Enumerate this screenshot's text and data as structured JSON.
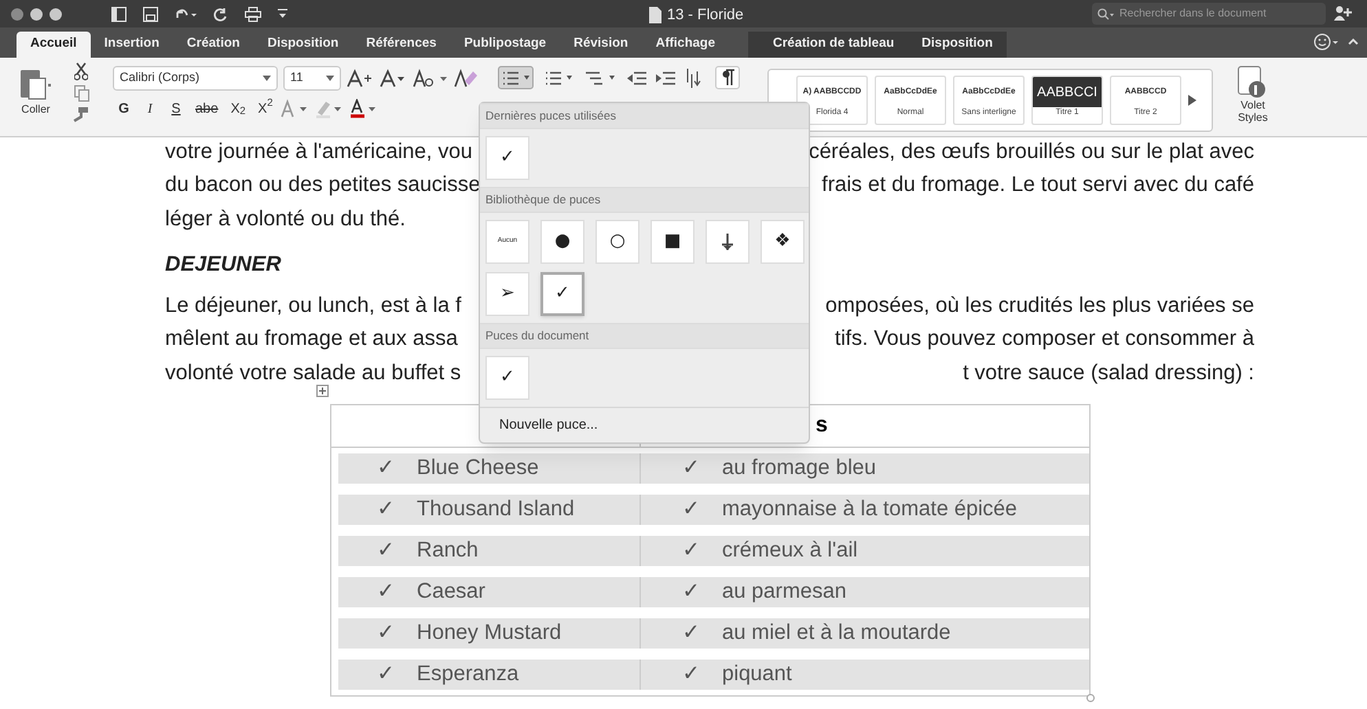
{
  "window": {
    "title": "13 - Floride",
    "search_placeholder": "Rechercher dans le document"
  },
  "tabs": [
    {
      "label": "Accueil",
      "selected": true,
      "contextual": false
    },
    {
      "label": "Insertion",
      "selected": false,
      "contextual": false
    },
    {
      "label": "Création",
      "selected": false,
      "contextual": false
    },
    {
      "label": "Disposition",
      "selected": false,
      "contextual": false
    },
    {
      "label": "Références",
      "selected": false,
      "contextual": false
    },
    {
      "label": "Publipostage",
      "selected": false,
      "contextual": false
    },
    {
      "label": "Révision",
      "selected": false,
      "contextual": false
    },
    {
      "label": "Affichage",
      "selected": false,
      "contextual": false
    },
    {
      "label": "Création de tableau",
      "selected": false,
      "contextual": true
    },
    {
      "label": "Disposition",
      "selected": false,
      "contextual": true
    }
  ],
  "ribbon": {
    "paste_label": "Coller",
    "font": "Calibri (Corps)",
    "size": "11",
    "format_buttons": [
      {
        "label": "G",
        "kind": "bold"
      },
      {
        "label": "I",
        "kind": "italic"
      },
      {
        "label": "S",
        "kind": "underline"
      },
      {
        "label": "abe",
        "kind": "strike"
      },
      {
        "label": "X$_{2}$",
        "kind": "plain"
      },
      {
        "label": "X$^{2}$",
        "kind": "plain"
      }
    ],
    "styles": [
      {
        "preview": "A) AABBCCDD",
        "name": "Florida 4",
        "dark": false
      },
      {
        "preview": "AaBbCcDdEe",
        "name": "Normal",
        "dark": false
      },
      {
        "preview": "AaBbCcDdEe",
        "name": "Sans interligne",
        "dark": false
      },
      {
        "preview": "AABBCCI",
        "name": "Titre 1",
        "dark": true
      },
      {
        "preview": "AABBCCD",
        "name": "Titre 2",
        "dark": false
      }
    ],
    "styles_pane": [
      "Volet",
      "Styles"
    ]
  },
  "document": {
    "lines": [
      {
        "kind": "split",
        "left": "votre journée à l'américaine, vou",
        "right": "céréales, des œufs brouillés ou sur le plat avec"
      },
      {
        "kind": "split",
        "left": "du bacon ou des petites saucisse",
        "right": "frais et du fromage. Le tout servi avec du café"
      },
      {
        "kind": "plain",
        "left": "léger à volonté ou du thé."
      },
      {
        "kind": "heading",
        "left": "DEJEUNER"
      },
      {
        "kind": "split",
        "left": "Le déjeuner, ou lunch, est à la f",
        "right": "omposées, où les crudités les plus variées se"
      },
      {
        "kind": "split",
        "left": "mêlent au fromage et aux assa",
        "right": "tifs. Vous pouvez composer et consommer à"
      },
      {
        "kind": "split",
        "left": "volonté votre salade au buffet s",
        "right": "t votre sauce (salad dressing) :"
      }
    ],
    "table": {
      "column_2_header": "s",
      "rows": [
        {
          "left": {
            "bullet": "✓",
            "text": "Blue Cheese"
          },
          "right": {
            "bullet": "✓",
            "text": "au fromage bleu"
          }
        },
        {
          "left": {
            "bullet": "✓",
            "text": "Thousand Island"
          },
          "right": {
            "bullet": "✓",
            "text": "mayonnaise à la tomate épicée"
          }
        },
        {
          "left": {
            "bullet": "✓",
            "text": "Ranch"
          },
          "right": {
            "bullet": "✓",
            "text": "crémeux à l'ail"
          }
        },
        {
          "left": {
            "bullet": "✓",
            "text": "Caesar"
          },
          "right": {
            "bullet": "✓",
            "text": "au parmesan"
          }
        },
        {
          "left": {
            "bullet": "✓",
            "text": "Honey Mustard"
          },
          "right": {
            "bullet": "✓",
            "text": "au miel et à la moutarde"
          }
        },
        {
          "left": {
            "bullet": "✓",
            "text": "Esperanza"
          },
          "right": {
            "bullet": "✓",
            "text": "piquant"
          }
        }
      ]
    }
  },
  "bullet_menu": {
    "sections": [
      {
        "title": "Dernières puces utilisées",
        "items": [
          {
            "kind": "glyph",
            "glyph": "✓",
            "selected": false
          }
        ]
      },
      {
        "title": "Bibliothèque de puces",
        "items": [
          {
            "kind": "none",
            "glyph": "Aucun",
            "selected": false
          },
          {
            "kind": "glyph",
            "glyph": "●",
            "selected": false
          },
          {
            "kind": "glyph",
            "glyph": "○",
            "selected": false
          },
          {
            "kind": "glyph",
            "glyph": "■",
            "selected": false
          },
          {
            "kind": "icon",
            "selected": false
          },
          {
            "kind": "glyph",
            "glyph": "❖",
            "selected": false
          },
          {
            "kind": "glyph",
            "glyph": "➢",
            "selected": false
          },
          {
            "kind": "glyph",
            "glyph": "✓",
            "selected": true
          }
        ]
      },
      {
        "title": "Puces du document",
        "items": [
          {
            "kind": "glyph",
            "glyph": "✓",
            "selected": false
          }
        ]
      }
    ],
    "new_bullet": "Nouvelle puce..."
  }
}
